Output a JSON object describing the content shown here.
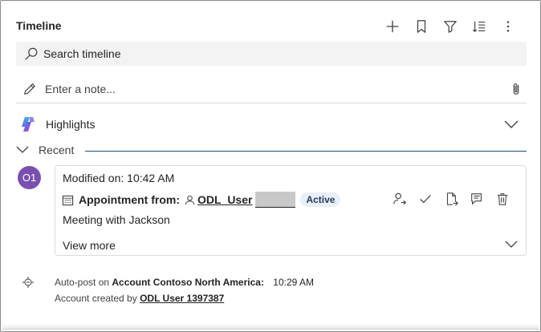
{
  "header": {
    "title": "Timeline",
    "toolbar": [
      "add-icon",
      "bookmark-icon",
      "filter-icon",
      "sort-icon",
      "more-icon"
    ]
  },
  "search": {
    "placeholder": "Search timeline"
  },
  "note": {
    "placeholder": "Enter a note..."
  },
  "highlights": {
    "label": "Highlights"
  },
  "recent": {
    "label": "Recent"
  },
  "activity": {
    "avatar_initials": "O1",
    "modified": "Modified on: 10:42 AM",
    "type_label": "Appointment from:",
    "user": "ODL_User",
    "status": "Active",
    "description": "Meeting with Jackson",
    "view_more": "View more",
    "actions": [
      "assign-icon",
      "complete-icon",
      "convert-icon",
      "open-record-icon",
      "delete-icon"
    ]
  },
  "autopost": {
    "prefix": "Auto-post on",
    "entity": "Account Contoso North America:",
    "time": "10:29 AM",
    "created_by_text": "Account created by",
    "created_by_user": "ODL User 1397387"
  },
  "colors": {
    "avatar_bg": "#7a4fb0",
    "recent_line": "#1f4f7a",
    "badge_bg": "#e8f0fa",
    "search_bg": "#f3f3f3"
  }
}
